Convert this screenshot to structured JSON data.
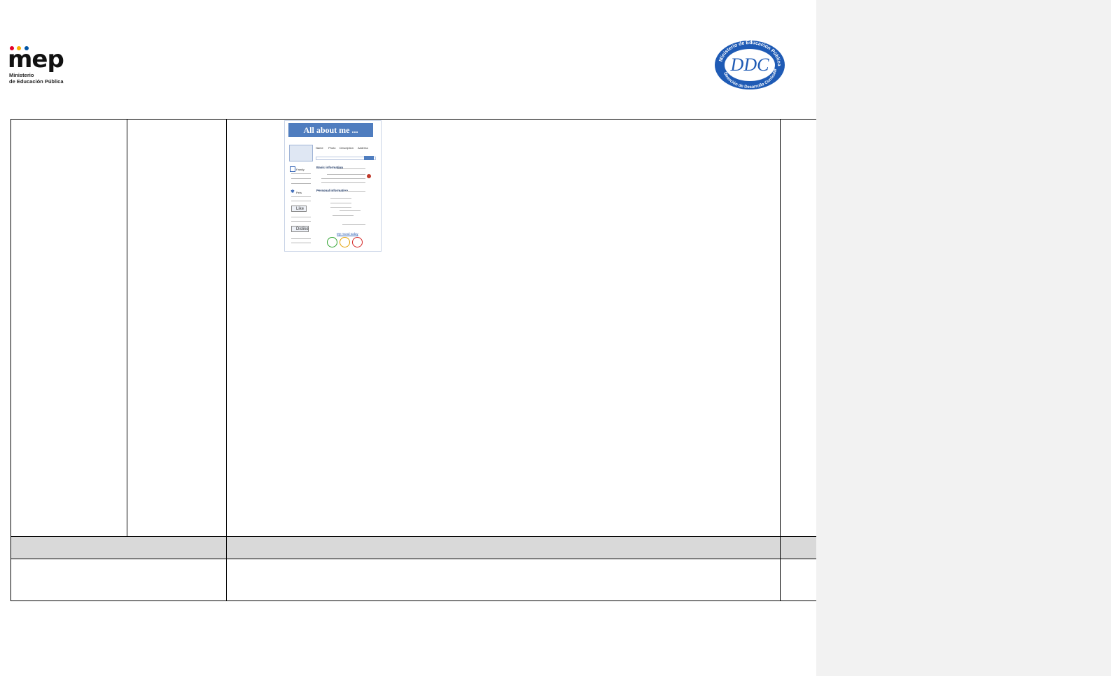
{
  "header": {
    "left_logo": {
      "wordmark": "mep",
      "subtitle_line1": "Ministerio",
      "subtitle_line2": "de Educación Pública",
      "dot_colors": [
        "#e4002b",
        "#f9b000",
        "#0055a5"
      ]
    },
    "right_logo": {
      "ring_text": "Ministerio de Educación Pública · Dirección de Desarrollo Curricular",
      "monogram": "DDC",
      "color": "#1f5bb5"
    }
  },
  "worksheet": {
    "title": "All about me ...",
    "nav_items": [
      "Name",
      "Photo",
      "Description",
      "Address"
    ],
    "sections": [
      "Basic information",
      "Personal information"
    ],
    "side_labels": [
      "Family",
      "Pets"
    ],
    "buttons": [
      "Like",
      "Dislike"
    ],
    "mood_prompt": "My mood today",
    "mood_icons": [
      "happy-face-icon",
      "neutral-face-icon",
      "sad-face-icon"
    ],
    "mood_colors": [
      "#2aa02a",
      "#e2a000",
      "#d22020"
    ]
  },
  "table": {
    "header_fill": "#d9d9d9",
    "border_color": "#000000"
  }
}
